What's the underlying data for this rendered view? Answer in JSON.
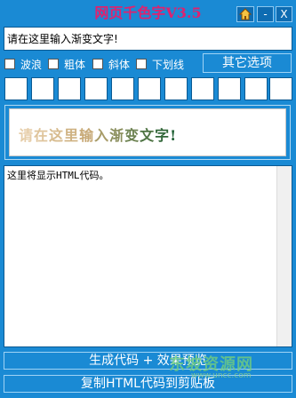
{
  "window": {
    "title": "网页千色字V3.5",
    "home_icon": "home-icon",
    "minimize_label": "-",
    "close_label": "X"
  },
  "input": {
    "value": "请在这里输入渐变文字!"
  },
  "options": {
    "wave": "波浪",
    "bold": "粗体",
    "italic": "斜体",
    "underline": "下划线",
    "other": "其它选项"
  },
  "swatches": [
    "",
    "",
    "",
    "",
    "",
    "",
    "",
    "",
    "",
    "",
    ""
  ],
  "preview": {
    "chars": [
      "请",
      "在",
      "这",
      "里",
      "输",
      "入",
      "渐",
      "变",
      "文",
      "字",
      "!"
    ],
    "colors": [
      "#e6cda8",
      "#dfc49b",
      "#d7bb8e",
      "#cfb282",
      "#c7a976",
      "#a89c69",
      "#8a8e5c",
      "#6c8150",
      "#4f7444",
      "#33683a",
      "#1a5c30"
    ]
  },
  "code": {
    "text": "这里将显示HTML代码。"
  },
  "buttons": {
    "generate": "生成代码 + 效果预览",
    "copy": "复制HTML代码到剪贴板"
  },
  "watermark": {
    "text": "东坡资源网",
    "sub": "www.uncc.com"
  }
}
